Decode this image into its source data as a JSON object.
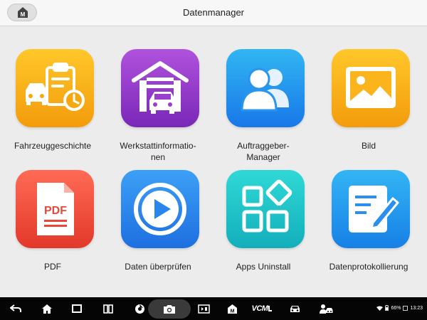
{
  "header": {
    "title": "Datenmanager",
    "home_icon": "home-m-icon"
  },
  "apps": [
    {
      "label": "Fahrzeuggeschichte",
      "icon": "vehicle-history-icon",
      "gradient": [
        "#ffc72a",
        "#f39c0b"
      ]
    },
    {
      "label": "Werkstattinformatio-\nnen",
      "icon": "garage-icon",
      "gradient": [
        "#b052dc",
        "#7a27b8"
      ]
    },
    {
      "label": "Auftraggeber-\nManager",
      "icon": "customers-icon",
      "gradient": [
        "#31b6f3",
        "#1877e8"
      ]
    },
    {
      "label": "Bild",
      "icon": "image-icon",
      "gradient": [
        "#ffc72a",
        "#f39c0b"
      ]
    },
    {
      "label": "PDF",
      "icon": "pdf-icon",
      "gradient": [
        "#ff6b55",
        "#e2382a"
      ]
    },
    {
      "label": "Daten überprüfen",
      "icon": "play-icon",
      "gradient": [
        "#3ca0f6",
        "#1e6fe0"
      ]
    },
    {
      "label": "Apps Uninstall",
      "icon": "apps-grid-icon",
      "gradient": [
        "#2fd9d6",
        "#13aebb"
      ]
    },
    {
      "label": "Datenprotokollierung",
      "icon": "data-log-icon",
      "gradient": [
        "#33b5f5",
        "#1780e6"
      ]
    }
  ],
  "navbar": {
    "vcm_label": "VCM",
    "battery": "66%",
    "time": "13:23"
  }
}
